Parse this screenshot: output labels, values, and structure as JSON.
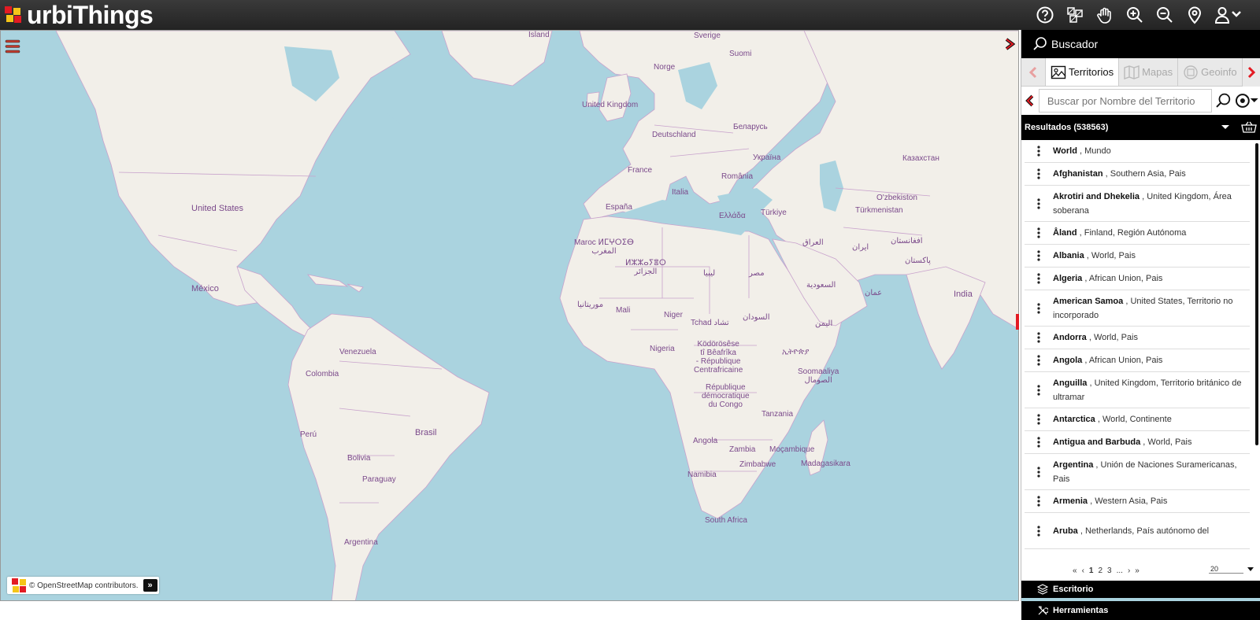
{
  "app": {
    "logo_text": "urbiThings"
  },
  "header_tools": [
    {
      "name": "help-icon"
    },
    {
      "name": "layers-switch-icon"
    },
    {
      "name": "pan-hand-icon"
    },
    {
      "name": "zoom-in-icon"
    },
    {
      "name": "zoom-out-icon"
    },
    {
      "name": "location-pin-icon"
    },
    {
      "name": "user-menu-icon"
    }
  ],
  "map": {
    "labels": {
      "island": "Island",
      "sverige": "Sverige",
      "suomi": "Suomi",
      "norge": "Norge",
      "united_kingdom": "United Kingdom",
      "deutschland": "Deutschland",
      "belarus": "Беларусь",
      "ukraina": "Україна",
      "kazakhstan": "Казахстан",
      "france": "France",
      "romania": "România",
      "espana": "España",
      "italia": "Italia",
      "ellada": "Ελλάδα",
      "turkiye": "Türkiye",
      "ozbekiston": "O'zbekiston",
      "turkmenistan": "Türkmenistan",
      "united_states": "United States",
      "maroc": "Maroc ⵍⵎⵖⵔⵉⴱ\nالمغرب",
      "algeria": "ⵍⵣⵣⴰⵢⴻⵔ\nالجزائر",
      "libya": "ليبيا",
      "misr": "مصر",
      "iraq": "العراق",
      "iran": "ایران",
      "afghanistan": "افغانستان",
      "pakistan": "پاکستان",
      "mexico": "México",
      "saudi": "السعودية",
      "oman": "عمان",
      "india": "India",
      "mauritania": "موريتانيا",
      "mali": "Mali",
      "niger": "Niger",
      "tchad": "Tchad تشاد",
      "sudan": "السودان",
      "yemen": "اليمن",
      "venezuela": "Venezuela",
      "nigeria": "Nigeria",
      "car": "Ködörösêse\ntî Bêafrîka\n- République\nCentrafricaine",
      "ethiopia": "ኢትዮጵያ",
      "somalia": "Soomaaliya\nالصومال",
      "colombia": "Colombia",
      "drc": "République\ndémocratique\ndu Congo",
      "tanzania": "Tanzania",
      "brasil": "Brasil",
      "peru": "Perú",
      "angola": "Angola",
      "zambia": "Zambia",
      "mocambique": "Moçambique",
      "bolivia": "Bolivia",
      "zimbabwe": "Zimbabwe",
      "madagasikara": "Madagasikara",
      "namibia": "Namibia",
      "paraguay": "Paraguay",
      "south_africa": "South Africa",
      "argentina": "Argentina"
    },
    "attribution": "© OpenStreetMap contributors.",
    "attribution_button": "»"
  },
  "panel": {
    "title": "Buscador",
    "tabs": [
      {
        "label": "Territorios",
        "active": true
      },
      {
        "label": "Mapas",
        "active": false
      },
      {
        "label": "Geoinfo",
        "active": false
      }
    ],
    "search_placeholder": "Buscar por Nombre del Territorio",
    "results_label": "Resultados (538563)",
    "results": [
      {
        "name": "World",
        "detail": ", Mundo"
      },
      {
        "name": "Afghanistan",
        "detail": ", Southern Asia, Pais"
      },
      {
        "name": "Akrotiri and Dhekelia",
        "detail": ", United Kingdom, Área soberana"
      },
      {
        "name": "Åland",
        "detail": ", Finland, Región Autónoma"
      },
      {
        "name": "Albania",
        "detail": ", World, Pais"
      },
      {
        "name": "Algeria",
        "detail": ", African Union, Pais"
      },
      {
        "name": "American Samoa",
        "detail": ", United States, Territorio no incorporado"
      },
      {
        "name": "Andorra",
        "detail": ", World, Pais"
      },
      {
        "name": "Angola",
        "detail": ", African Union, Pais"
      },
      {
        "name": "Anguilla",
        "detail": ", United Kingdom, Territorio británico de ultramar"
      },
      {
        "name": "Antarctica",
        "detail": ", World, Continente"
      },
      {
        "name": "Antigua and Barbuda",
        "detail": ", World, Pais"
      },
      {
        "name": "Argentina",
        "detail": ", Unión de Naciones Suramericanas, Pais"
      },
      {
        "name": "Armenia",
        "detail": ", Western Asia, Pais"
      },
      {
        "name": "Aruba",
        "detail": ", Netherlands, País autónomo del"
      }
    ],
    "pager": {
      "first": "«",
      "prev": "‹",
      "pages": [
        "1",
        "2",
        "3"
      ],
      "ellipsis": "...",
      "next": "›",
      "last": "»",
      "page_size": "20"
    },
    "sections": [
      {
        "label": "Escritorio"
      },
      {
        "label": "Herramientas"
      }
    ]
  },
  "colors": {
    "header_bg": "#2b2b2b",
    "water": "#aad3df",
    "land": "#f2efe9",
    "border": "#c8a2cc",
    "label": "#7b4a8b",
    "accent_red": "#e31b23"
  }
}
